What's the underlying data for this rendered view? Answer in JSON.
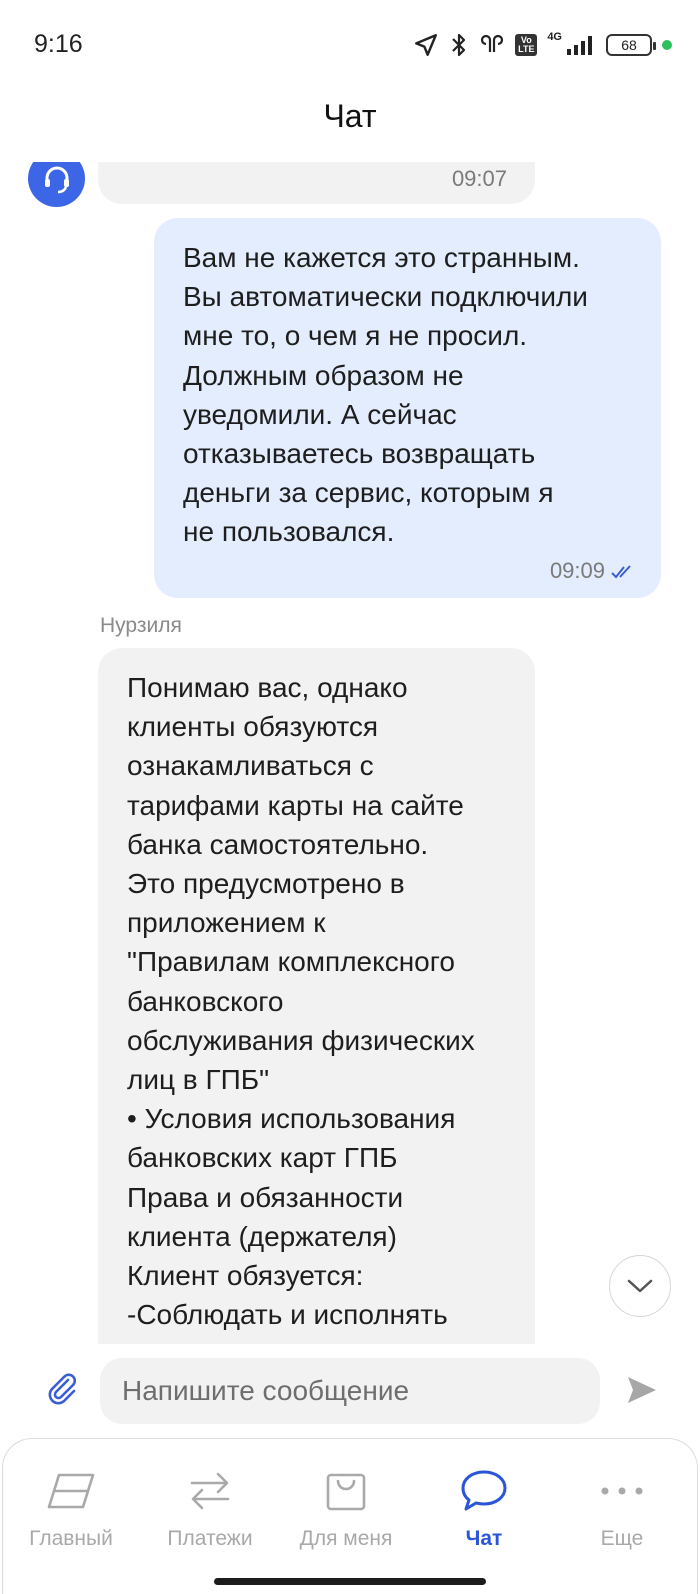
{
  "status_bar": {
    "time": "9:16",
    "network": "4G",
    "volte": "Vo LTE",
    "battery": "68"
  },
  "header": {
    "title": "Чат"
  },
  "messages": [
    {
      "id": "m1",
      "direction": "incoming",
      "time": "09:07"
    },
    {
      "id": "m2",
      "direction": "outgoing",
      "lines": [
        "Вам не кажется это странным.",
        "Вы автоматически подключили",
        "мне то, о чем я не просил.",
        "Должным образом не",
        "уведомили. А сейчас",
        "отказываетесь возвращать",
        "деньги за сервис, которым я",
        "не пользовался."
      ],
      "time": "09:09",
      "status": "read"
    },
    {
      "id": "m3",
      "direction": "incoming",
      "sender": "Нурзиля",
      "lines": [
        "Понимаю вас, однако",
        "клиенты обязуются",
        "ознакамливаться с",
        "тарифами карты на сайте",
        "банка самостоятельно.",
        "Это предусмотрено в",
        "приложением к",
        "\"Правилам комплексного",
        "банковского",
        "обслуживания физических",
        "лиц в ГПБ\"",
        "• Условия использования",
        "банковских карт ГПБ",
        "Права и обязанности",
        "клиента (держателя)",
        "Клиент обязуется:",
        "-Соблюдать и исполнять"
      ]
    }
  ],
  "input": {
    "placeholder": "Напишите сообщение"
  },
  "nav": [
    {
      "label": "Главный",
      "icon": "home-card-icon",
      "active": false
    },
    {
      "label": "Платежи",
      "icon": "transfer-arrows-icon",
      "active": false
    },
    {
      "label": "Для меня",
      "icon": "shopping-bag-icon",
      "active": false
    },
    {
      "label": "Чат",
      "icon": "chat-bubble-icon",
      "active": true
    },
    {
      "label": "Еще",
      "icon": "more-dots-icon",
      "active": false
    }
  ],
  "colors": {
    "accent": "#2a55d6",
    "avatar": "#3d66e6",
    "outgoing_bubble": "#e3edfd",
    "incoming_bubble": "#f2f2f2",
    "inactive": "#a9a9a9"
  }
}
